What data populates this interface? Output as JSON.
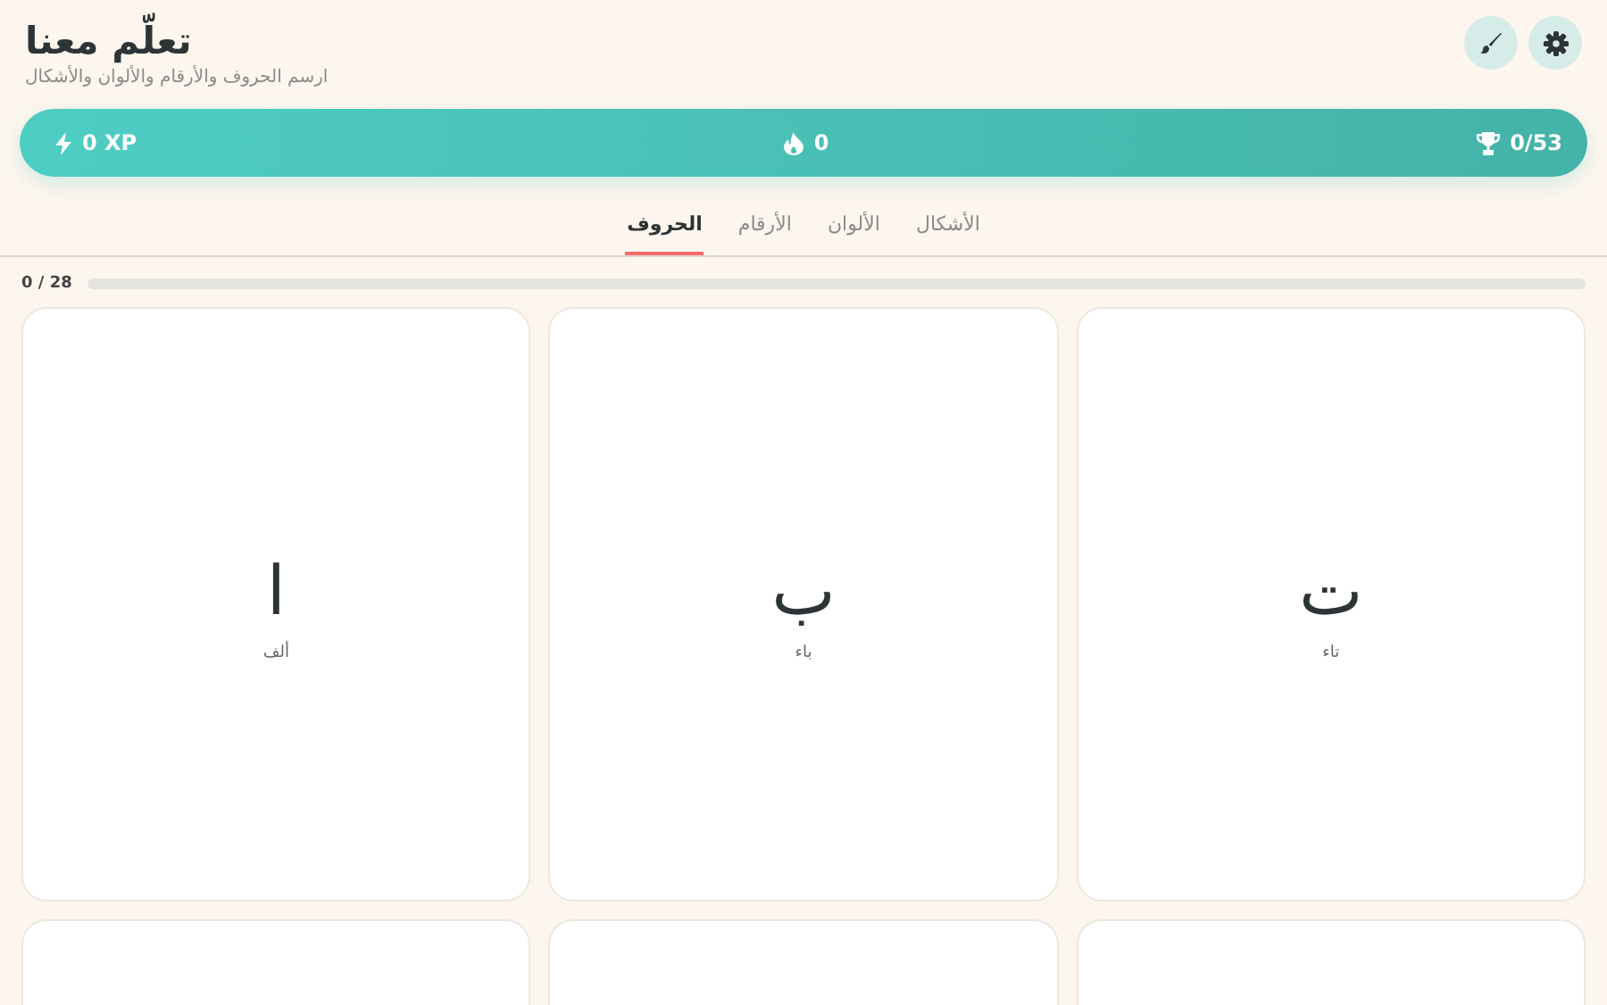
{
  "header": {
    "title": "تعلّم معنا",
    "subtitle": "ارسم الحروف والأرقام والألوان والأشكال"
  },
  "stats": {
    "xp": "0 XP",
    "streak": "0",
    "trophies": "0/53"
  },
  "tabs": [
    {
      "label": "الأشكال",
      "selected": false
    },
    {
      "label": "الألوان",
      "selected": false
    },
    {
      "label": "الأرقام",
      "selected": false
    },
    {
      "label": "الحروف",
      "selected": true
    }
  ],
  "progress": {
    "reading": "0 / 28",
    "level": 0
  },
  "cards": [
    {
      "kind": "letter",
      "letter": "ت",
      "name": "تاء"
    },
    {
      "kind": "letter",
      "letter": "ب",
      "name": "باء"
    },
    {
      "kind": "letter",
      "letter": "ا",
      "name": "ألف"
    },
    {
      "kind": "blank"
    },
    {
      "kind": "blank"
    },
    {
      "kind": "blank"
    }
  ]
}
